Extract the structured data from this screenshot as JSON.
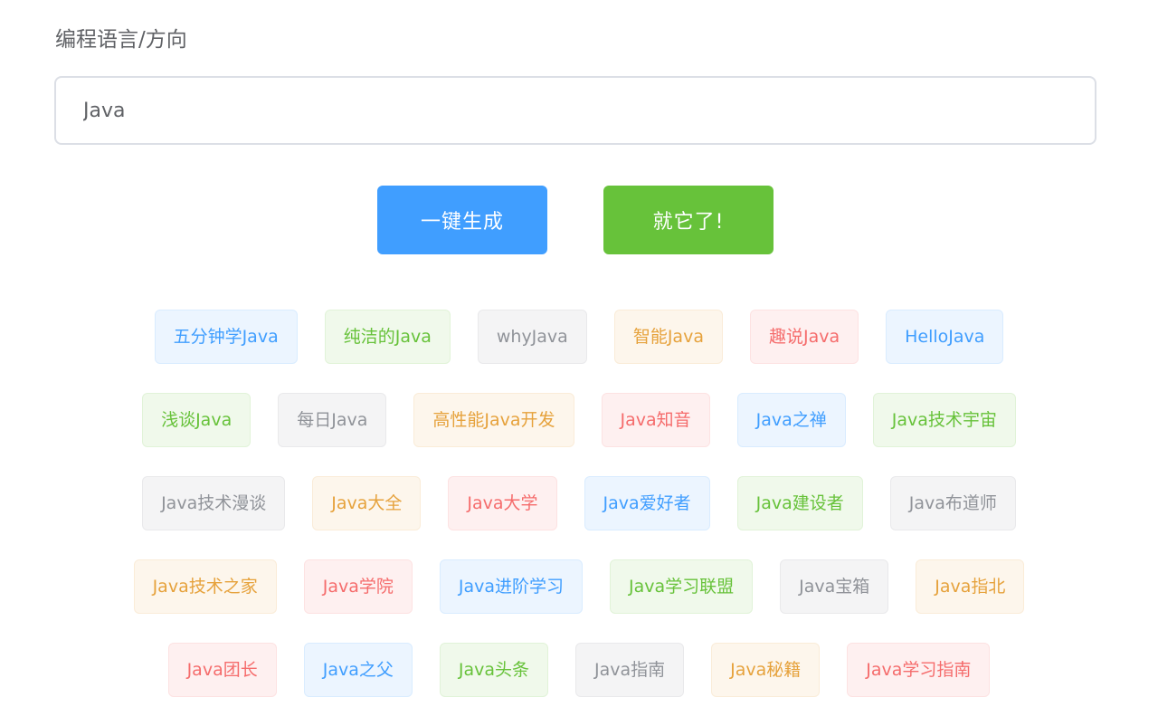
{
  "form": {
    "label": "编程语言/方向",
    "input_value": "Java",
    "generate_label": "一键生成",
    "confirm_label": "就它了!"
  },
  "colors": {
    "primary": "#409eff",
    "success": "#67c23a",
    "info": "#909399",
    "warning": "#e6a23c",
    "danger": "#f56c6c"
  },
  "tag_rows": [
    [
      {
        "text": "五分钟学Java",
        "color": "blue"
      },
      {
        "text": "纯洁的Java",
        "color": "green"
      },
      {
        "text": "whyJava",
        "color": "gray"
      },
      {
        "text": "智能Java",
        "color": "orange"
      },
      {
        "text": "趣说Java",
        "color": "red"
      },
      {
        "text": "HelloJava",
        "color": "blue"
      }
    ],
    [
      {
        "text": "浅谈Java",
        "color": "green"
      },
      {
        "text": "每日Java",
        "color": "gray"
      },
      {
        "text": "高性能Java开发",
        "color": "orange"
      },
      {
        "text": "Java知音",
        "color": "red"
      },
      {
        "text": "Java之禅",
        "color": "blue"
      },
      {
        "text": "Java技术宇宙",
        "color": "green"
      }
    ],
    [
      {
        "text": "Java技术漫谈",
        "color": "gray"
      },
      {
        "text": "Java大全",
        "color": "orange"
      },
      {
        "text": "Java大学",
        "color": "red"
      },
      {
        "text": "Java爱好者",
        "color": "blue"
      },
      {
        "text": "Java建设者",
        "color": "green"
      },
      {
        "text": "Java布道师",
        "color": "gray"
      }
    ],
    [
      {
        "text": "Java技术之家",
        "color": "orange"
      },
      {
        "text": "Java学院",
        "color": "red"
      },
      {
        "text": "Java进阶学习",
        "color": "blue"
      },
      {
        "text": "Java学习联盟",
        "color": "green"
      },
      {
        "text": "Java宝箱",
        "color": "gray"
      },
      {
        "text": "Java指北",
        "color": "orange"
      }
    ],
    [
      {
        "text": "Java团长",
        "color": "red"
      },
      {
        "text": "Java之父",
        "color": "blue"
      },
      {
        "text": "Java头条",
        "color": "green"
      },
      {
        "text": "Java指南",
        "color": "gray"
      },
      {
        "text": "Java秘籍",
        "color": "orange"
      },
      {
        "text": "Java学习指南",
        "color": "red"
      }
    ]
  ]
}
